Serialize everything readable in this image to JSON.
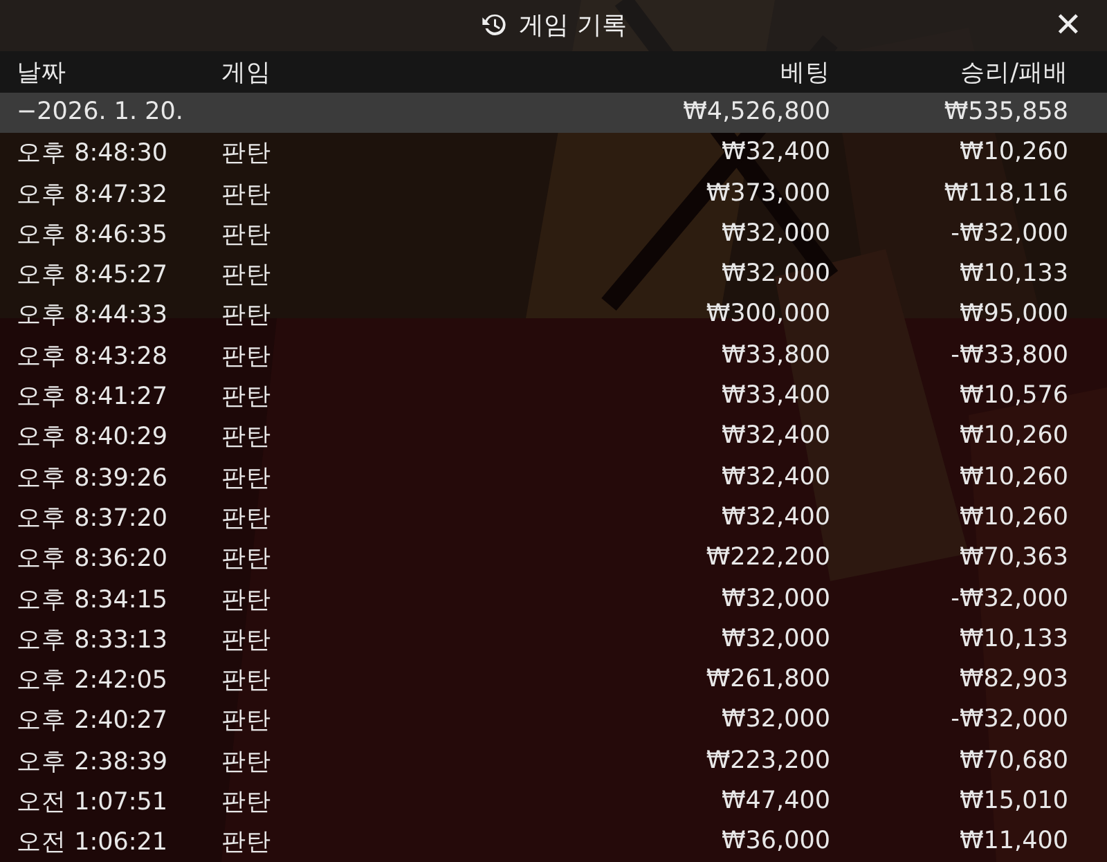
{
  "header": {
    "title": "게임 기록",
    "close": "✕"
  },
  "table": {
    "columns": [
      "날짜",
      "게임",
      "베팅",
      "승리/패배"
    ],
    "summary": {
      "date": "−2026. 1. 20.",
      "bet": "₩4,526,800",
      "result": "₩535,858"
    },
    "rows": [
      {
        "time": "오후 8:48:30",
        "game": "판탄",
        "bet": "₩32,400",
        "result": "₩10,260"
      },
      {
        "time": "오후 8:47:32",
        "game": "판탄",
        "bet": "₩373,000",
        "result": "₩118,116"
      },
      {
        "time": "오후 8:46:35",
        "game": "판탄",
        "bet": "₩32,000",
        "result": "-₩32,000"
      },
      {
        "time": "오후 8:45:27",
        "game": "판탄",
        "bet": "₩32,000",
        "result": "₩10,133"
      },
      {
        "time": "오후 8:44:33",
        "game": "판탄",
        "bet": "₩300,000",
        "result": "₩95,000"
      },
      {
        "time": "오후 8:43:28",
        "game": "판탄",
        "bet": "₩33,800",
        "result": "-₩33,800"
      },
      {
        "time": "오후 8:41:27",
        "game": "판탄",
        "bet": "₩33,400",
        "result": "₩10,576"
      },
      {
        "time": "오후 8:40:29",
        "game": "판탄",
        "bet": "₩32,400",
        "result": "₩10,260"
      },
      {
        "time": "오후 8:39:26",
        "game": "판탄",
        "bet": "₩32,400",
        "result": "₩10,260"
      },
      {
        "time": "오후 8:37:20",
        "game": "판탄",
        "bet": "₩32,400",
        "result": "₩10,260"
      },
      {
        "time": "오후 8:36:20",
        "game": "판탄",
        "bet": "₩222,200",
        "result": "₩70,363"
      },
      {
        "time": "오후 8:34:15",
        "game": "판탄",
        "bet": "₩32,000",
        "result": "-₩32,000"
      },
      {
        "time": "오후 8:33:13",
        "game": "판탄",
        "bet": "₩32,000",
        "result": "₩10,133"
      },
      {
        "time": "오후 2:42:05",
        "game": "판탄",
        "bet": "₩261,800",
        "result": "₩82,903"
      },
      {
        "time": "오후 2:40:27",
        "game": "판탄",
        "bet": "₩32,000",
        "result": "-₩32,000"
      },
      {
        "time": "오후 2:38:39",
        "game": "판탄",
        "bet": "₩223,200",
        "result": "₩70,680"
      },
      {
        "time": "오전 1:07:51",
        "game": "판탄",
        "bet": "₩47,400",
        "result": "₩15,010"
      },
      {
        "time": "오전 1:06:21",
        "game": "판탄",
        "bet": "₩36,000",
        "result": "₩11,400"
      }
    ]
  }
}
